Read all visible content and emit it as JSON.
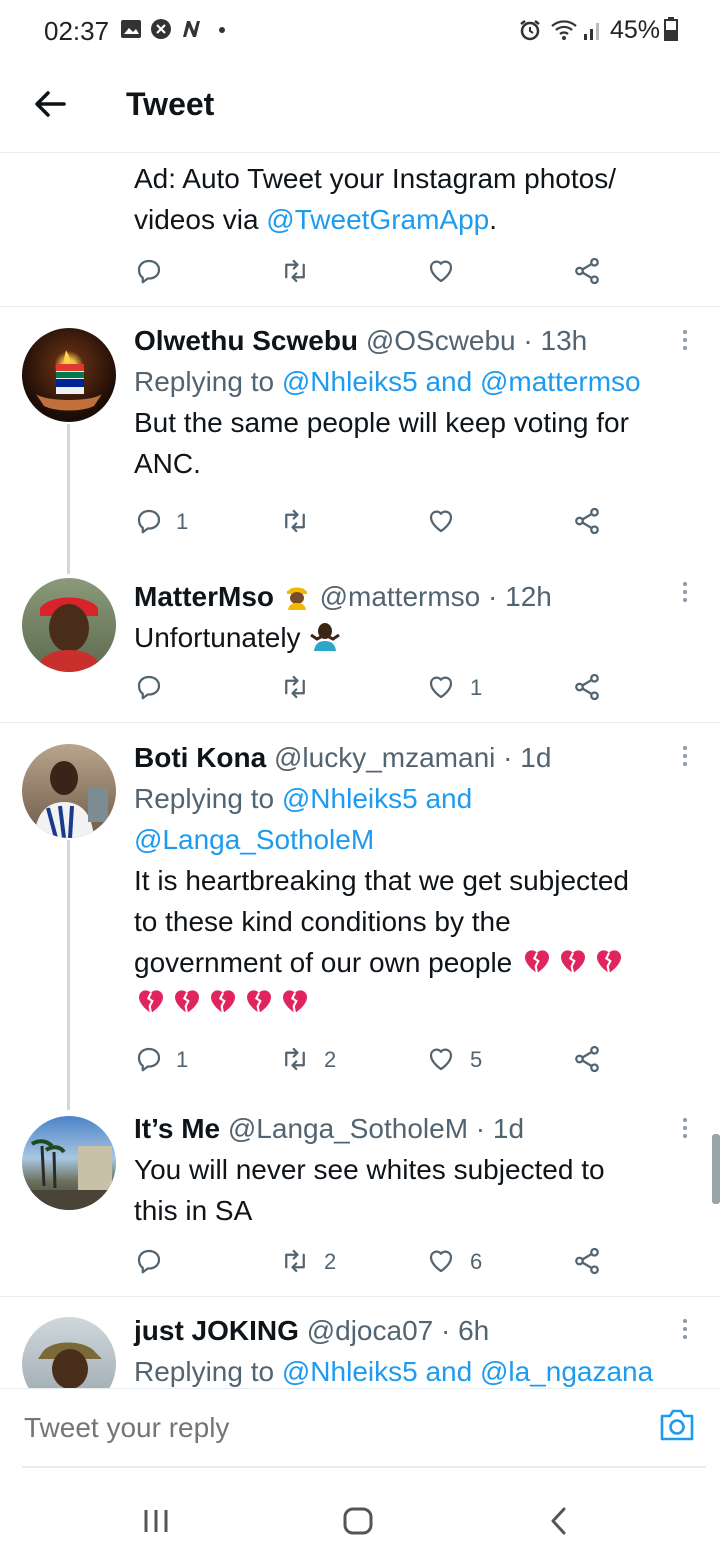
{
  "status_bar": {
    "time": "02:37",
    "battery": "45%"
  },
  "header": {
    "title": "Tweet"
  },
  "ad": {
    "text": "Ad: Auto Tweet your Instagram photos/",
    "text2": "videos via ",
    "link": "@TweetGramApp",
    "after": "."
  },
  "tweets": [
    {
      "name": "Olwethu Scwebu",
      "handle": "@OScwebu · 13h",
      "replying_prefix": "Replying to ",
      "replying_to": "@Nhleiks5 and @mattermso",
      "body1": "But the same people will keep voting for",
      "body2": "ANC.",
      "replies": "1",
      "retweets": "",
      "likes": ""
    },
    {
      "name": "MatterMso",
      "handle": "@mattermso · 12h",
      "body1": "Unfortunately",
      "replies": "",
      "retweets": "",
      "likes": "1"
    },
    {
      "name": "Boti Kona",
      "handle": "@lucky_mzamani · 1d",
      "replying_prefix": "Replying to ",
      "replying_to": "@Nhleiks5 and",
      "replying_to2": "@Langa_SotholeM",
      "body1": "It is heartbreaking that we get subjected",
      "body2": "to these kind conditions by the",
      "body3": "government of our own people",
      "replies": "1",
      "retweets": "2",
      "likes": "5"
    },
    {
      "name": "It’s Me",
      "handle": "@Langa_SotholeM · 1d",
      "body1": "You will never see whites subjected to",
      "body2": "this in SA",
      "replies": "",
      "retweets": "2",
      "likes": "6"
    },
    {
      "name": "just JOKING",
      "handle": "@djoca07 · 6h",
      "replying_prefix": "Replying to ",
      "replying_to": "@Nhleiks5 and @la_ngazana"
    }
  ],
  "reply_bar": {
    "placeholder": "Tweet your reply"
  },
  "icons": {
    "accent": "#1d9bf0",
    "reply": "reply-icon",
    "retweet": "retweet-icon",
    "like": "heart-icon",
    "share": "share-icon"
  }
}
